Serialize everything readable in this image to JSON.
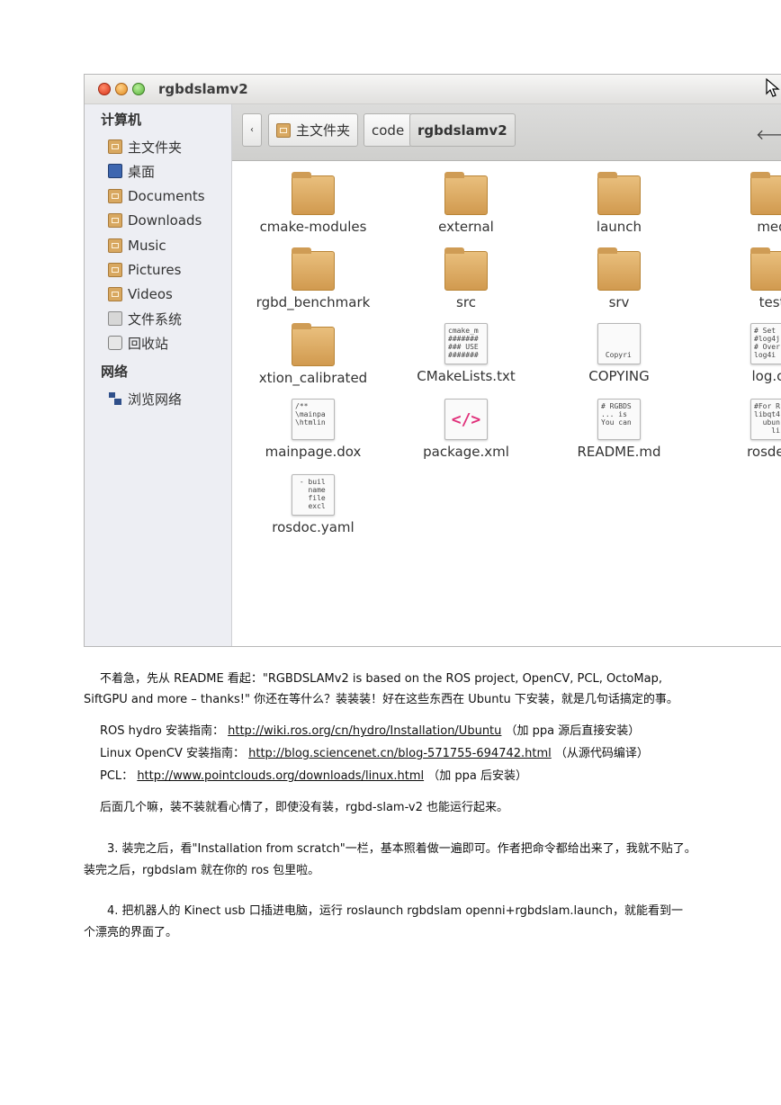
{
  "window": {
    "title": "rgbdslamv2",
    "sidebar": {
      "section_computer": "计算机",
      "computer_items": [
        {
          "label": "主文件夹",
          "icon": "home-folder-icon"
        },
        {
          "label": "桌面",
          "icon": "desktop-icon"
        },
        {
          "label": "Documents",
          "icon": "documents-folder-icon"
        },
        {
          "label": "Downloads",
          "icon": "downloads-folder-icon"
        },
        {
          "label": "Music",
          "icon": "music-folder-icon"
        },
        {
          "label": "Pictures",
          "icon": "pictures-folder-icon"
        },
        {
          "label": "Videos",
          "icon": "videos-folder-icon"
        },
        {
          "label": "文件系统",
          "icon": "drive-icon"
        },
        {
          "label": "回收站",
          "icon": "trash-icon"
        }
      ],
      "section_network": "网络",
      "network_items": [
        {
          "label": "浏览网络",
          "icon": "network-icon"
        }
      ]
    },
    "pathbar": {
      "back": "‹",
      "home": "主文件夹",
      "code": "code",
      "current": "rgbdslamv2",
      "forward": "🡐"
    },
    "files": [
      {
        "name": "cmake-modules",
        "type": "folder",
        "preview": ""
      },
      {
        "name": "external",
        "type": "folder",
        "preview": ""
      },
      {
        "name": "launch",
        "type": "folder",
        "preview": ""
      },
      {
        "name": "med",
        "type": "folder",
        "preview": ""
      },
      {
        "name": "rgbd_benchmark",
        "type": "folder",
        "preview": ""
      },
      {
        "name": "src",
        "type": "folder",
        "preview": ""
      },
      {
        "name": "srv",
        "type": "folder",
        "preview": ""
      },
      {
        "name": "test",
        "type": "folder",
        "preview": ""
      },
      {
        "name": "xtion_calibrated",
        "type": "folder",
        "preview": ""
      },
      {
        "name": "CMakeLists.txt",
        "type": "doc",
        "preview": "cmake_m\n#######\n### USE\n#######"
      },
      {
        "name": "COPYING",
        "type": "doc",
        "preview": "\n\n\n Copyri"
      },
      {
        "name": "log.co",
        "type": "doc",
        "preview": "# Set\n#log4j\n# Over\nlog4i"
      },
      {
        "name": "mainpage.dox",
        "type": "doc",
        "preview": "/**\n\\mainpa\n\\htmlin"
      },
      {
        "name": "package.xml",
        "type": "xml",
        "preview": "</>"
      },
      {
        "name": "README.md",
        "type": "doc",
        "preview": "# RGBDS\n... is\nYou can"
      },
      {
        "name": "rosdep.",
        "type": "doc",
        "preview": "#For R\nlibqt4\n  ubun\n    li"
      },
      {
        "name": "rosdoc.yaml",
        "type": "doc",
        "preview": " - buil\n   name\n   file\n   excl"
      }
    ]
  },
  "article": {
    "p1_line1": "不着急，先从 README 看起：\"RGBDSLAMv2 is based on the ROS project, OpenCV, PCL, OctoMap,",
    "p1_line2": "SiftGPU and more – thanks!\" 你还在等什么？装装装！好在这些东西在 Ubuntu 下安装，就是几句话搞定的事。",
    "install_lines": [
      {
        "prefix": "ROS hydro 安装指南：",
        "link": "http://wiki.ros.org/cn/hydro/Installation/Ubuntu",
        "suffix": "（加 ppa 源后直接安装）"
      },
      {
        "prefix": "Linux OpenCV 安装指南：",
        "link": "http://blog.sciencenet.cn/blog-571755-694742.html",
        "suffix": "（从源代码编译）"
      },
      {
        "prefix": "PCL：",
        "link": "http://www.pointclouds.org/downloads/linux.html",
        "suffix": "（加 ppa 后安装）"
      }
    ],
    "p2": "后面几个嘛，装不装就看心情了，即使没有装，rgbd-slam-v2 也能运行起来。",
    "p3_line1": "3. 装完之后，看\"Installation from scratch\"一栏，基本照着做一遍即可。作者把命令都给出来了，我就不贴了。",
    "p3_line2": "装完之后，rgbdslam 就在你的 ros 包里啦。",
    "p4_line1": "4. 把机器人的 Kinect usb 口插进电脑，运行 roslaunch rgbdslam openni+rgbdslam.launch，就能看到一",
    "p4_line2": "个漂亮的界面了。"
  }
}
